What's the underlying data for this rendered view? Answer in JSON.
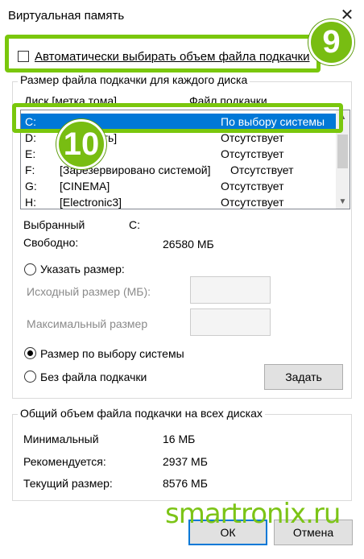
{
  "window": {
    "title": "Виртуальная память",
    "close_glyph": "✕"
  },
  "auto": {
    "label": "Автоматически выбирать объем файла подкачки",
    "checked": false
  },
  "badges": {
    "nine": "9",
    "ten": "10",
    "color": "#7ac70c"
  },
  "per_disk": {
    "legend": "Размер файла подкачки для каждого диска",
    "columns": {
      "disk": "Диск [метка тома]",
      "paging": "Файл подкачки"
    },
    "rows": [
      {
        "disk": "C:",
        "label": "",
        "paging": "По выбору системы",
        "selected": true
      },
      {
        "disk": "D:",
        "label": "[Обновить]",
        "paging": "Отсутствует"
      },
      {
        "disk": "E:",
        "label": "",
        "paging": "Отсутствует"
      },
      {
        "disk": "F:",
        "label": "[Зарезервировано системой]",
        "paging": "Отсутствует"
      },
      {
        "disk": "G:",
        "label": "[CINEMA]",
        "paging": "Отсутствует"
      },
      {
        "disk": "H:",
        "label": "[Electronic3]",
        "paging": "Отсутствует"
      }
    ],
    "selected_label": "Выбранный",
    "selected_value": "C:",
    "free_label": "Свободно:",
    "free_value": "26580 МБ",
    "custom_size_label": "Указать размер:",
    "initial_size_label": "Исходный размер (МБ):",
    "max_size_label": "Максимальный размер",
    "system_managed_label": "Размер по выбору системы",
    "no_paging_label": "Без файла подкачки",
    "set_button": "Задать",
    "selected_option": "system_managed"
  },
  "totals": {
    "legend": "Общий объем файла подкачки на всех дисках",
    "min_label": "Минимальный",
    "min_value": "16 МБ",
    "recommended_label": "Рекомендуется:",
    "recommended_value": "2937 МБ",
    "current_label": "Текущий размер:",
    "current_value": "8576 МБ"
  },
  "buttons": {
    "ok": "ОК",
    "cancel": "Отмена"
  },
  "watermark": "smartronix.ru",
  "colors": {
    "selection": "#0078d7",
    "highlight": "#7ac70c"
  }
}
